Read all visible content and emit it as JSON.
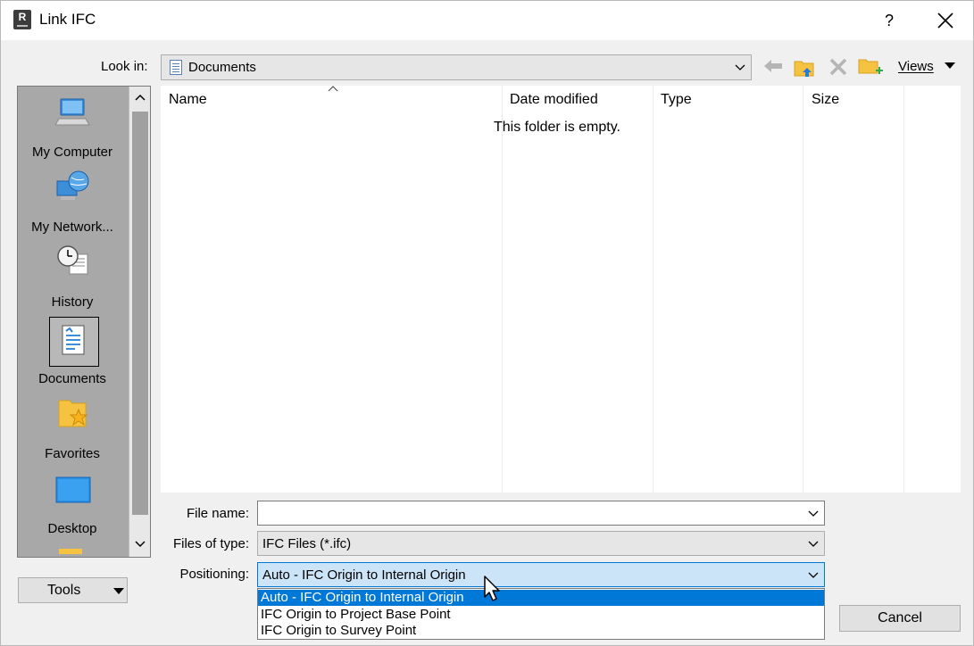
{
  "window": {
    "title": "Link IFC",
    "help_label": "?"
  },
  "lookin": {
    "label": "Look in:",
    "value": "Documents"
  },
  "toolbar": {
    "views_label": "Views"
  },
  "places": [
    {
      "label": "My Computer",
      "icon": "computer-icon"
    },
    {
      "label": "My Network...",
      "icon": "network-globe-icon"
    },
    {
      "label": "History",
      "icon": "history-clock-icon"
    },
    {
      "label": "Documents",
      "icon": "documents-icon",
      "selected": true
    },
    {
      "label": "Favorites",
      "icon": "favorites-folder-star-icon"
    },
    {
      "label": "Desktop",
      "icon": "desktop-icon"
    }
  ],
  "filelist": {
    "columns": [
      "Name",
      "Date modified",
      "Type",
      "Size"
    ],
    "empty_message": "This folder is empty."
  },
  "fields": {
    "file_name": {
      "label": "File name:",
      "value": ""
    },
    "files_of_type": {
      "label": "Files of type:",
      "value": "IFC Files (*.ifc)"
    },
    "positioning": {
      "label": "Positioning:",
      "value": "Auto - IFC Origin to Internal Origin",
      "options": [
        "Auto - IFC Origin to Internal Origin",
        "IFC Origin to Project Base Point",
        "IFC Origin to Survey Point"
      ]
    }
  },
  "buttons": {
    "tools": "Tools",
    "cancel": "Cancel"
  },
  "colors": {
    "selection": "#0078d7",
    "focus_fill": "#cce4f7",
    "places_bg": "#a8a8a8",
    "folder_yellow": "#f5c242"
  }
}
